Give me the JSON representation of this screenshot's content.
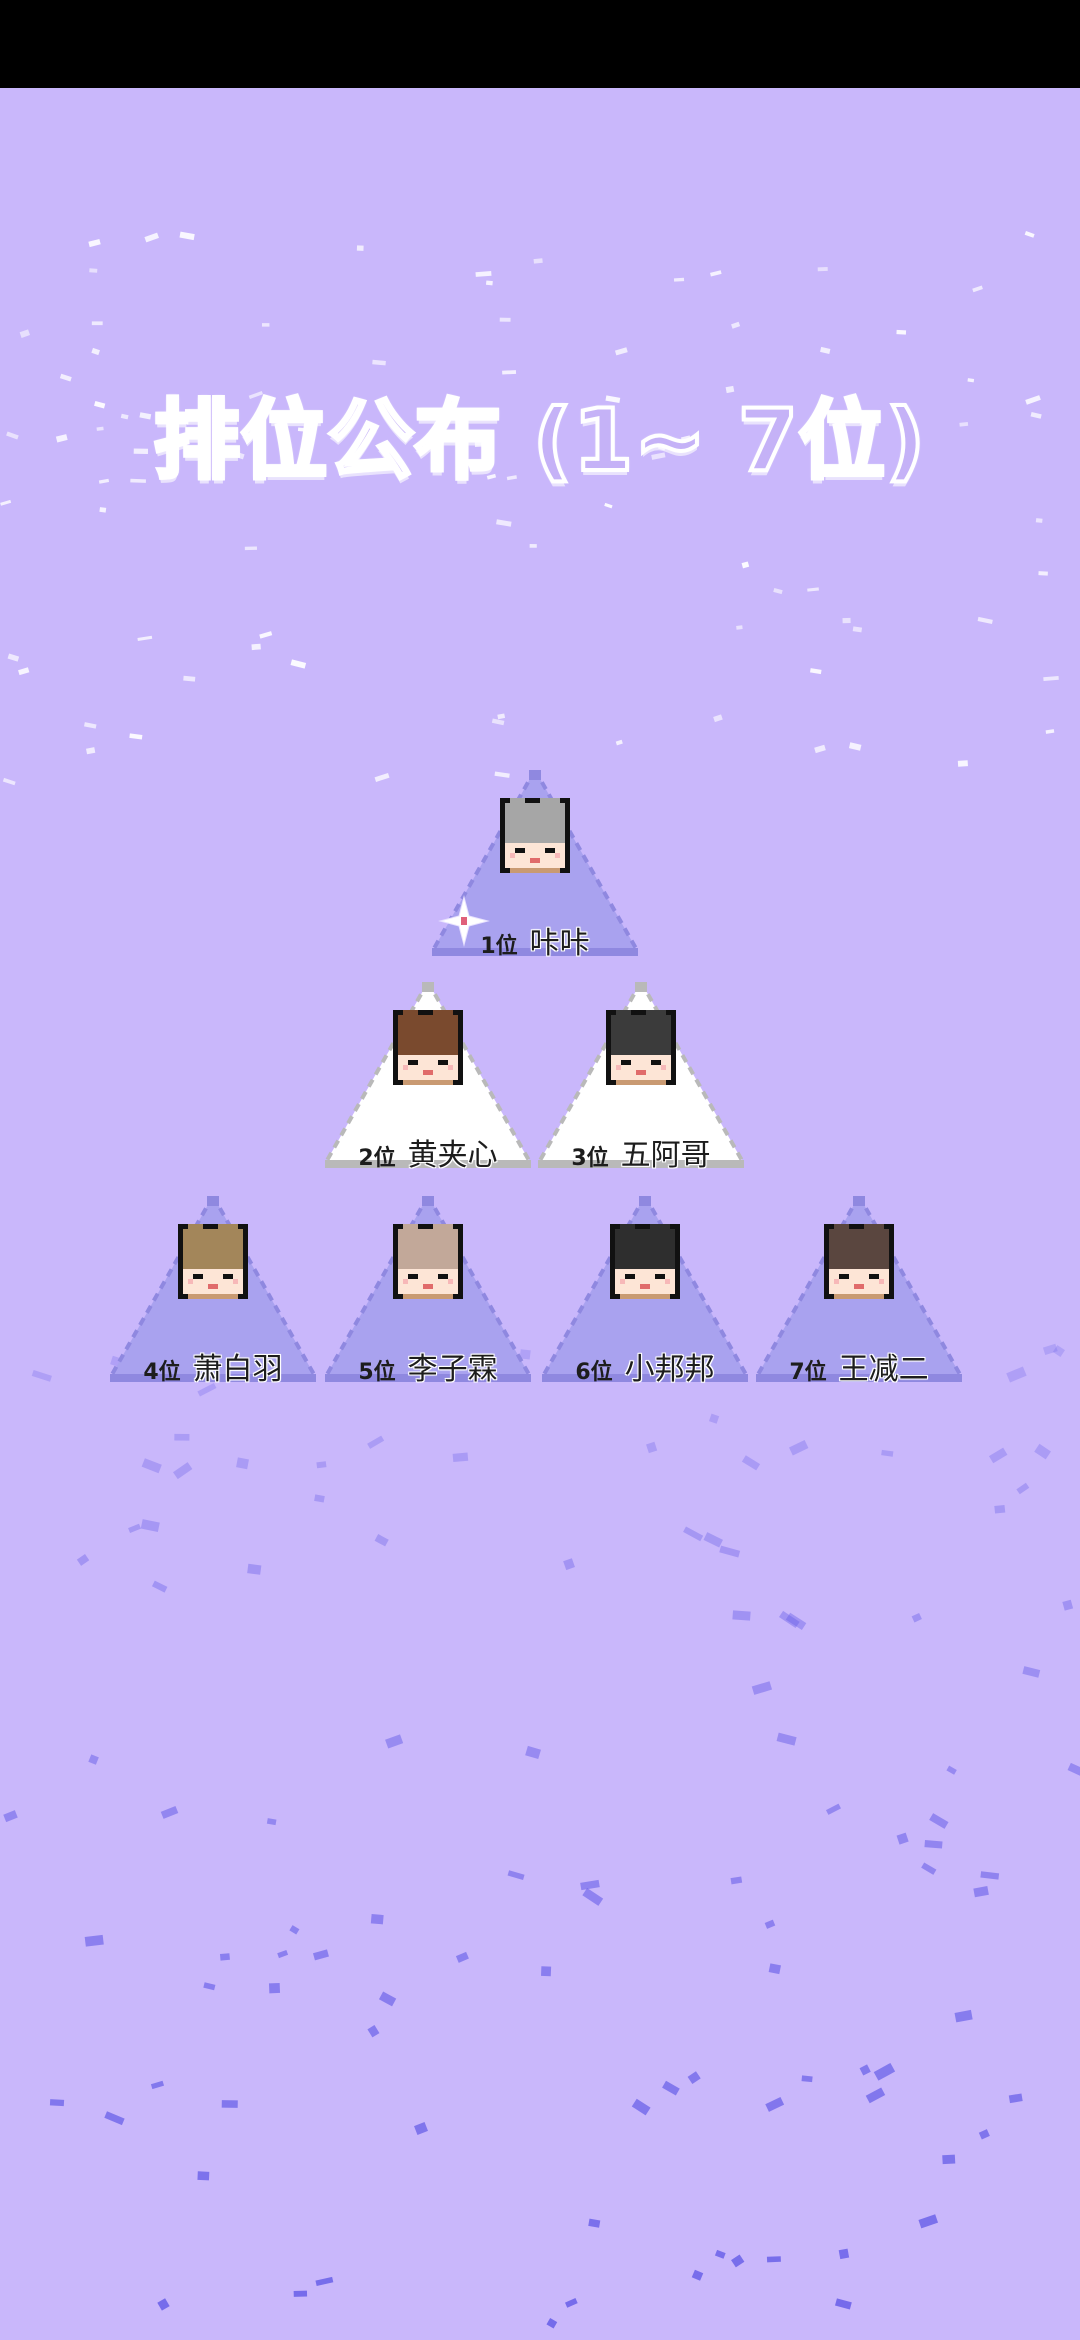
{
  "title": "排位公布 (1~ 7位)",
  "colors": {
    "background": "#c9b7fb",
    "purple_card": "#a9a2ef",
    "white_card": "#ffffff",
    "confetti_light": "#ffffff",
    "confetti_dark": "#6a61e8"
  },
  "ranking": [
    {
      "rank": "1位",
      "name": "咔咔",
      "card": "purple",
      "hair": "#a6a6a6"
    },
    {
      "rank": "2位",
      "name": "黄夹心",
      "card": "white",
      "hair": "#7a4a2e"
    },
    {
      "rank": "3位",
      "name": "五阿哥",
      "card": "white",
      "hair": "#3b3b3b"
    },
    {
      "rank": "4位",
      "name": "萧白羽",
      "card": "purple",
      "hair": "#a3865a"
    },
    {
      "rank": "5位",
      "name": "李子霖",
      "card": "purple",
      "hair": "#c2a899"
    },
    {
      "rank": "6位",
      "name": "小邦邦",
      "card": "purple",
      "hair": "#2e2e2e"
    },
    {
      "rank": "7位",
      "name": "王减二",
      "card": "purple",
      "hair": "#5a463f"
    }
  ],
  "icons": {
    "top_rank_marker": "sparkle-star-icon"
  }
}
